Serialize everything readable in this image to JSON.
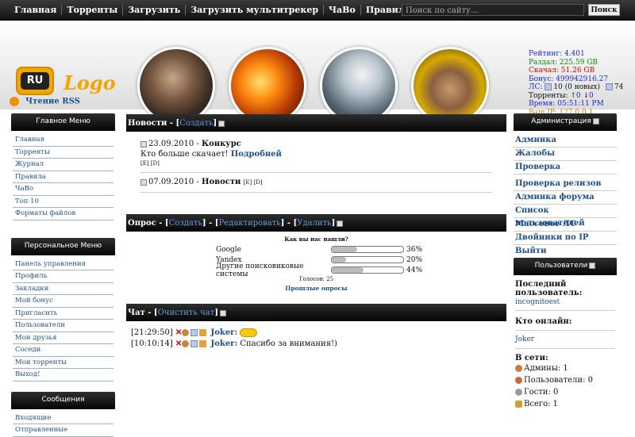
{
  "nav": [
    "Главная",
    "Торренты",
    "Загрузить",
    "Загрузить мультитрекер",
    "ЧаВо",
    "Правила",
    "Администрация"
  ],
  "search": {
    "placeholder": "Поиск по сайту...",
    "button": "Поиск"
  },
  "logo": {
    "badge": "RU",
    "text": "Logo"
  },
  "stats": {
    "rating": "Рейтинг: 4.401",
    "upload": "Раздал: 225.59 GB",
    "download": "Скачал: 51.26 GB",
    "bonus": "Бонус: 499942916.27",
    "pm_prefix": "ЛС:",
    "pm_count": "10 (0 новых)",
    "pm_out": "74",
    "torrents_label": "Торренты:",
    "seeding": "0",
    "leeching": "0",
    "time": "Время: 05:51:11 PM",
    "ip": "Ваш IP: 127.0.0.1"
  },
  "rss": "Чтение RSS",
  "main_menu": {
    "title": "Главное Меню",
    "items": [
      "Главная",
      "Торренты",
      "Журнал",
      "Правила",
      "ЧаВо",
      "Топ 10",
      "Форматы файлов"
    ]
  },
  "personal_menu": {
    "title": "Персональное Меню",
    "items": [
      "Панель управления",
      "Профиль",
      "Закладки",
      "Мой бонус",
      "Пригласить",
      "Пользователи",
      "Мои друзья",
      "Соседи",
      "Мои торренты",
      "Выход!"
    ]
  },
  "messages_menu": {
    "title": "Сообщения",
    "items": [
      "Входящие",
      "Отправленные"
    ]
  },
  "news": {
    "title": "Новости - [",
    "create": "Создать",
    "items": [
      {
        "date": "23.09.2010 - ",
        "title": "Конкурс",
        "body": "Кто больше скачает!",
        "more": "Подробней",
        "e": "[E]",
        "d": "[D]"
      },
      {
        "date": "07.09.2010 - ",
        "title": "Новости",
        "e": "[E]",
        "d": "[D]"
      }
    ]
  },
  "poll": {
    "title": "Опрос - [",
    "create": "Создать",
    "edit": "Редактировать",
    "delete": "Удалить",
    "question": "Как вы нас нашли?",
    "options": [
      {
        "label": "Google",
        "percent": 36,
        "text": "36%"
      },
      {
        "label": "Yandex",
        "percent": 20,
        "text": "20%"
      },
      {
        "label": "Другие поисковиковые системы",
        "percent": 44,
        "text": "44%"
      }
    ],
    "votes": "Голосов: 25",
    "past": "Прошлые опросы"
  },
  "chat": {
    "title": "Чат - [",
    "clear": "Очистить чат",
    "messages": [
      {
        "time": "[21:29:50]",
        "user": "Joker:",
        "text": ""
      },
      {
        "time": "[10:10:14]",
        "user": "Joker:",
        "text": "Спасибо за внимания!)"
      }
    ]
  },
  "admin": {
    "title": "Администрация",
    "items": [
      "Админка",
      "Жалобы",
      "Проверка",
      "Проверка релизов",
      "Админка форума",
      "Список пользователей",
      "Массовое ЛС",
      "Двойники по IP",
      "Выйти"
    ]
  },
  "users": {
    "title": "Пользователи",
    "last_label": "Последний пользователь:",
    "last_user": "incognitoest",
    "online_label": "Кто онлайн:",
    "online_user": "Joker",
    "net_label": "В сети:",
    "admins": "Админы: 1",
    "members": "Пользователи: 0",
    "guests": "Гости: 0",
    "total": "Всего: 1"
  },
  "colors": {
    "rating": "#1a2bd0",
    "upload": "#0a8a0a",
    "download": "#d40000",
    "bonus": "#1a2bd0",
    "time": "#1a2bd0",
    "ip": "#e07a00"
  }
}
